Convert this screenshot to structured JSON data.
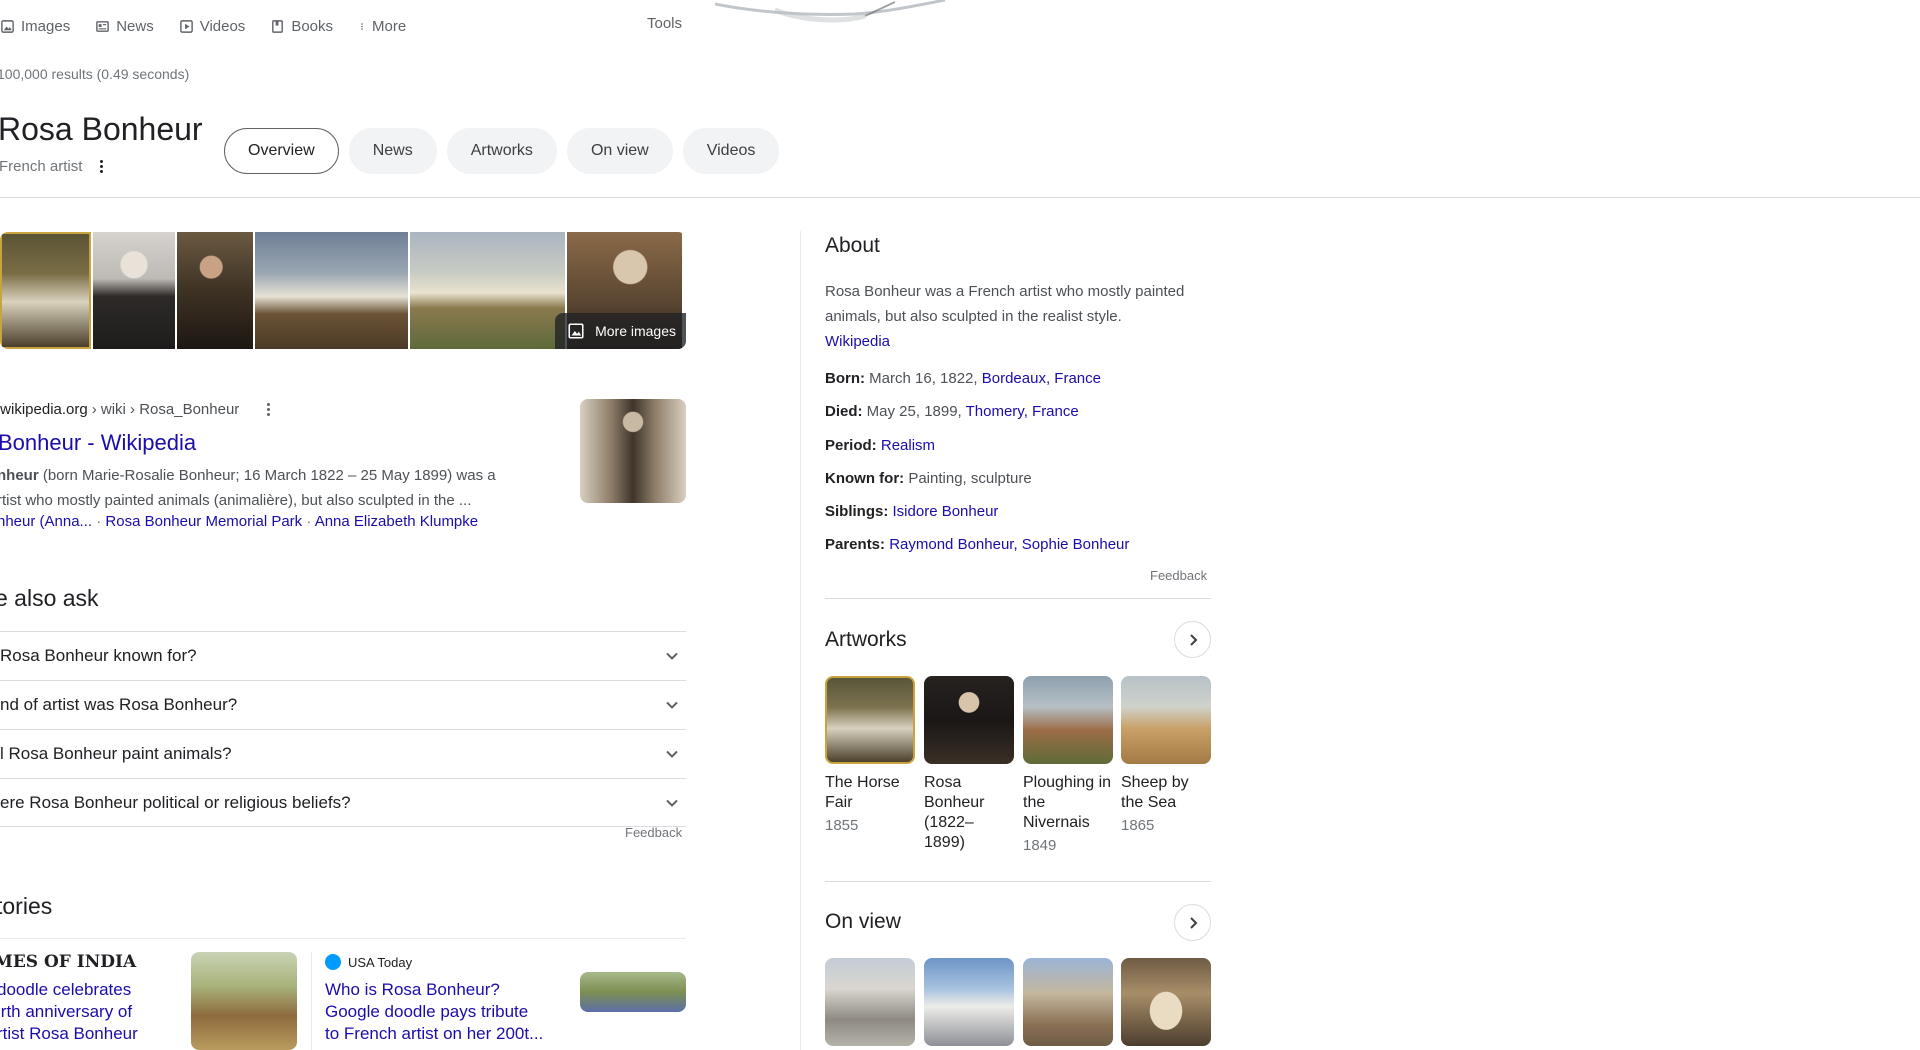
{
  "nav": {
    "items": [
      {
        "label": "Images",
        "icon": "image-icon"
      },
      {
        "label": "News",
        "icon": "news-icon"
      },
      {
        "label": "Videos",
        "icon": "play-icon"
      },
      {
        "label": "Books",
        "icon": "book-icon"
      },
      {
        "label": "More",
        "icon": "more-vert-icon"
      }
    ],
    "tools": "Tools"
  },
  "result_stats": "100,000 results (0.49 seconds)",
  "entity": {
    "name": "Rosa Bonheur",
    "subtitle": "French artist",
    "chips": [
      "Overview",
      "News",
      "Artworks",
      "On view",
      "Videos"
    ]
  },
  "images": {
    "more_label": "More images"
  },
  "wiki": {
    "url_host": ".wikipedia.org",
    "url_path": " › wiki › Rosa_Bonheur",
    "title": "Bonheur - Wikipedia",
    "snippet_bold": "nheur",
    "snippet_line1": " (born Marie-Rosalie Bonheur; 16 March 1822 – 25 May 1899) was a",
    "snippet_line2": "rtist who mostly painted animals (animalière), but also sculpted in the ...",
    "links": [
      "nheur (Anna...",
      "Rosa Bonheur Memorial Park",
      "Anna Elizabeth Klumpke"
    ],
    "sep": " · "
  },
  "paa": {
    "title": "e also ask",
    "questions": [
      " Rosa Bonheur known for?",
      "nd of artist was Rosa Bonheur?",
      "l Rosa Bonheur paint animals?",
      "ere Rosa Bonheur political or religious beliefs?"
    ],
    "feedback": "Feedback"
  },
  "stories": {
    "title": "tories",
    "items": [
      {
        "source": "MES OF INDIA",
        "lines": [
          "doodle celebrates",
          "irth anniversary of",
          "rtist Rosa Bonheur"
        ]
      },
      {
        "source": "USA Today",
        "lines": [
          "Who is Rosa Bonheur?",
          "Google doodle pays tribute",
          "to French artist on her 200t..."
        ]
      }
    ]
  },
  "about": {
    "heading": "About",
    "desc_line1": "Rosa Bonheur was a French artist who mostly painted",
    "desc_line2": "animals, but also sculpted in the realist style.",
    "source": "Wikipedia",
    "born_label": "Born:",
    "born_text": " March 16, 1822, ",
    "born_link": "Bordeaux, France",
    "died_label": "Died:",
    "died_text": " May 25, 1899, ",
    "died_link": "Thomery, France",
    "period_label": "Period:",
    "period_link": "Realism",
    "known_label": "Known for:",
    "known_text": " Painting, sculpture",
    "siblings_label": "Siblings:",
    "siblings_link": "Isidore Bonheur",
    "parents_label": "Parents:",
    "parents_link": "Raymond Bonheur, Sophie Bonheur",
    "feedback": "Feedback"
  },
  "artworks": {
    "heading": "Artworks",
    "items": [
      {
        "name": "The Horse Fair",
        "year": "1855"
      },
      {
        "name": "Rosa Bonheur (1822–1899)",
        "year": ""
      },
      {
        "name": "Ploughing in the Nivernais",
        "year": "1849"
      },
      {
        "name": "Sheep by the Sea",
        "year": "1865"
      }
    ]
  },
  "on_view": {
    "heading": "On view"
  }
}
